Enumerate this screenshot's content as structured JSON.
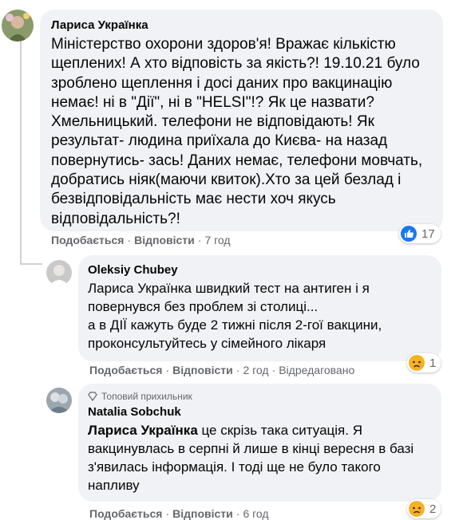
{
  "comments": [
    {
      "author": "Лариса Українка",
      "text": "Міністерство охорони здоров'я! Вражає кількістю щеплених! А хто відповість за якість?! 19.10.21 було зроблено щеплення і досі даних про вакцинацію немає! ні в \"Дії\", ні в \"HELSI\"!? Як це назвати? Хмельницький. телефони не відповідають! Як результат- людина приїхала до Києва- на назад повернутись- зась! Даних немає, телефони мовчать, добратись ніяк(маючи квиток).Хто за цей безлад і безвідповідальність має нести хоч якусь відповідальність?!",
      "like": "Подобається",
      "reply": "Відповісти",
      "time": "7 год",
      "reaction_count": "17",
      "reaction_icon": "like-icon"
    },
    {
      "author": "Oleksiy Chubey",
      "text_line1": "Лариса Українка швидкий тест на антиген і я повернувся без проблем зі столиці...",
      "text_line2": "а в ДІЇ кажуть буде 2 тижні після 2-гої вакцини, проконсультуйтесь у сімейного лікаря",
      "like": "Подобається",
      "reply": "Відповісти",
      "time": "2 год",
      "edited": "Відредаговано",
      "reaction_count": "1",
      "reaction_icon": "sad-icon"
    },
    {
      "badge": "Топовий прихильник",
      "author": "Natalia Sobchuk",
      "mention": "Лариса Українка",
      "text": " це скрізь така ситуація. Я вакцинувлась в серпні й лише в кінці вересня в базі з'явилась інформація. І тоді ще не було такого напливу",
      "like": "Подобається",
      "reply": "Відповісти",
      "time": "6 год",
      "reaction_count": "2",
      "reaction_icon": "sad-icon"
    }
  ],
  "colors": {
    "bubble": "#f0f2f5",
    "meta": "#65676b",
    "like_blue": "#1877f2",
    "sad_yellow": "#f7b125"
  }
}
